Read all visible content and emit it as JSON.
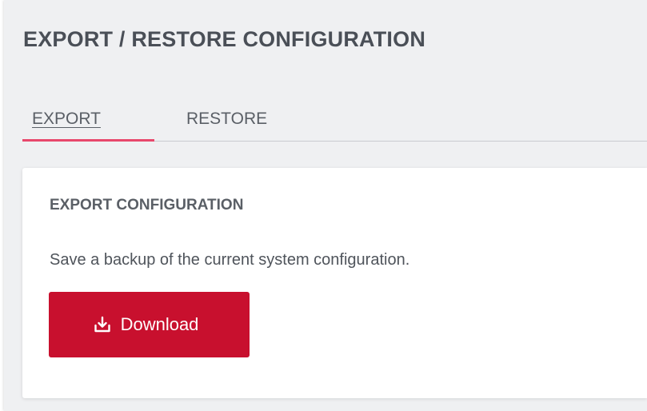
{
  "page": {
    "title": "EXPORT / RESTORE CONFIGURATION"
  },
  "tabs": [
    {
      "label": "EXPORT",
      "active": true
    },
    {
      "label": "RESTORE",
      "active": false
    }
  ],
  "export_card": {
    "title": "EXPORT CONFIGURATION",
    "description": "Save a backup of the current system configuration.",
    "button_label": "Download",
    "button_icon": "download-icon"
  },
  "colors": {
    "accent": "#e8476c",
    "button": "#c8102e",
    "background": "#eff0f2",
    "card": "#ffffff",
    "text": "#4a4f57"
  }
}
